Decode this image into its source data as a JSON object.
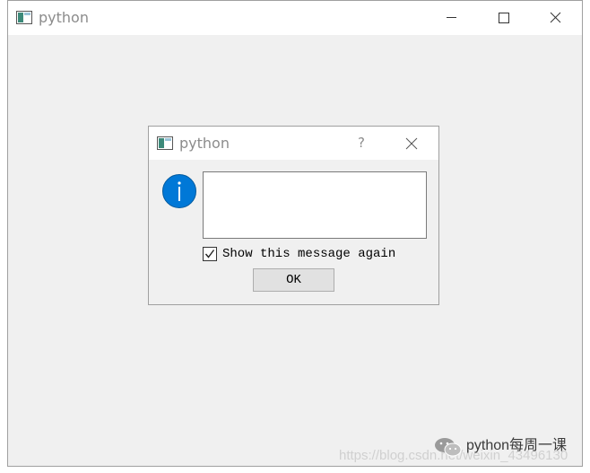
{
  "main_window": {
    "title": "python",
    "icon": "app-window-icon",
    "controls": {
      "minimize": "minimize-icon",
      "maximize": "maximize-icon",
      "close": "close-icon"
    }
  },
  "dialog": {
    "title": "python",
    "icon": "app-window-icon",
    "help_label": "?",
    "close": "close-icon",
    "message_icon": "information-icon",
    "message_text": "",
    "checkbox": {
      "label": "Show this message again",
      "checked": true
    },
    "ok_label": "OK"
  },
  "watermark": {
    "url": "https://blog.csdn.net/weixin_43496130",
    "brand": "python每周一课",
    "brand_icon": "wechat-icon"
  },
  "colors": {
    "window_bg": "#f0f0f0",
    "titlebar_bg": "#ffffff",
    "title_text": "#8c8c8c",
    "info_icon": "#0078d7",
    "button_bg": "#e1e1e1"
  }
}
